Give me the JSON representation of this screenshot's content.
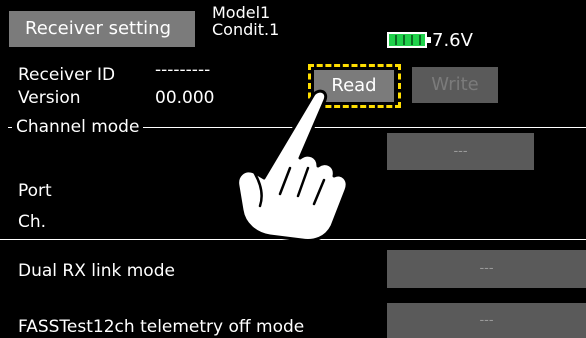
{
  "header": {
    "title": "Receiver setting",
    "model_name": "Model1",
    "condition": "Condit.1",
    "voltage": "7.6V",
    "battery_icon": "battery-icon",
    "battery_color": "#1fd14a"
  },
  "receiver": {
    "id_label": "Receiver ID",
    "id_value": "---------",
    "version_label": "Version",
    "version_value": "00.000",
    "read_label": "Read",
    "write_label": "Write"
  },
  "channel_mode": {
    "section_label": "Channel mode",
    "value": "---",
    "port_label": "Port",
    "ch_label": "Ch."
  },
  "options": [
    {
      "label": "Dual RX link mode",
      "value": "---"
    },
    {
      "label": "FASSTest12ch telemetry off mode",
      "value": "---"
    }
  ],
  "highlight_color": "#ffde00"
}
